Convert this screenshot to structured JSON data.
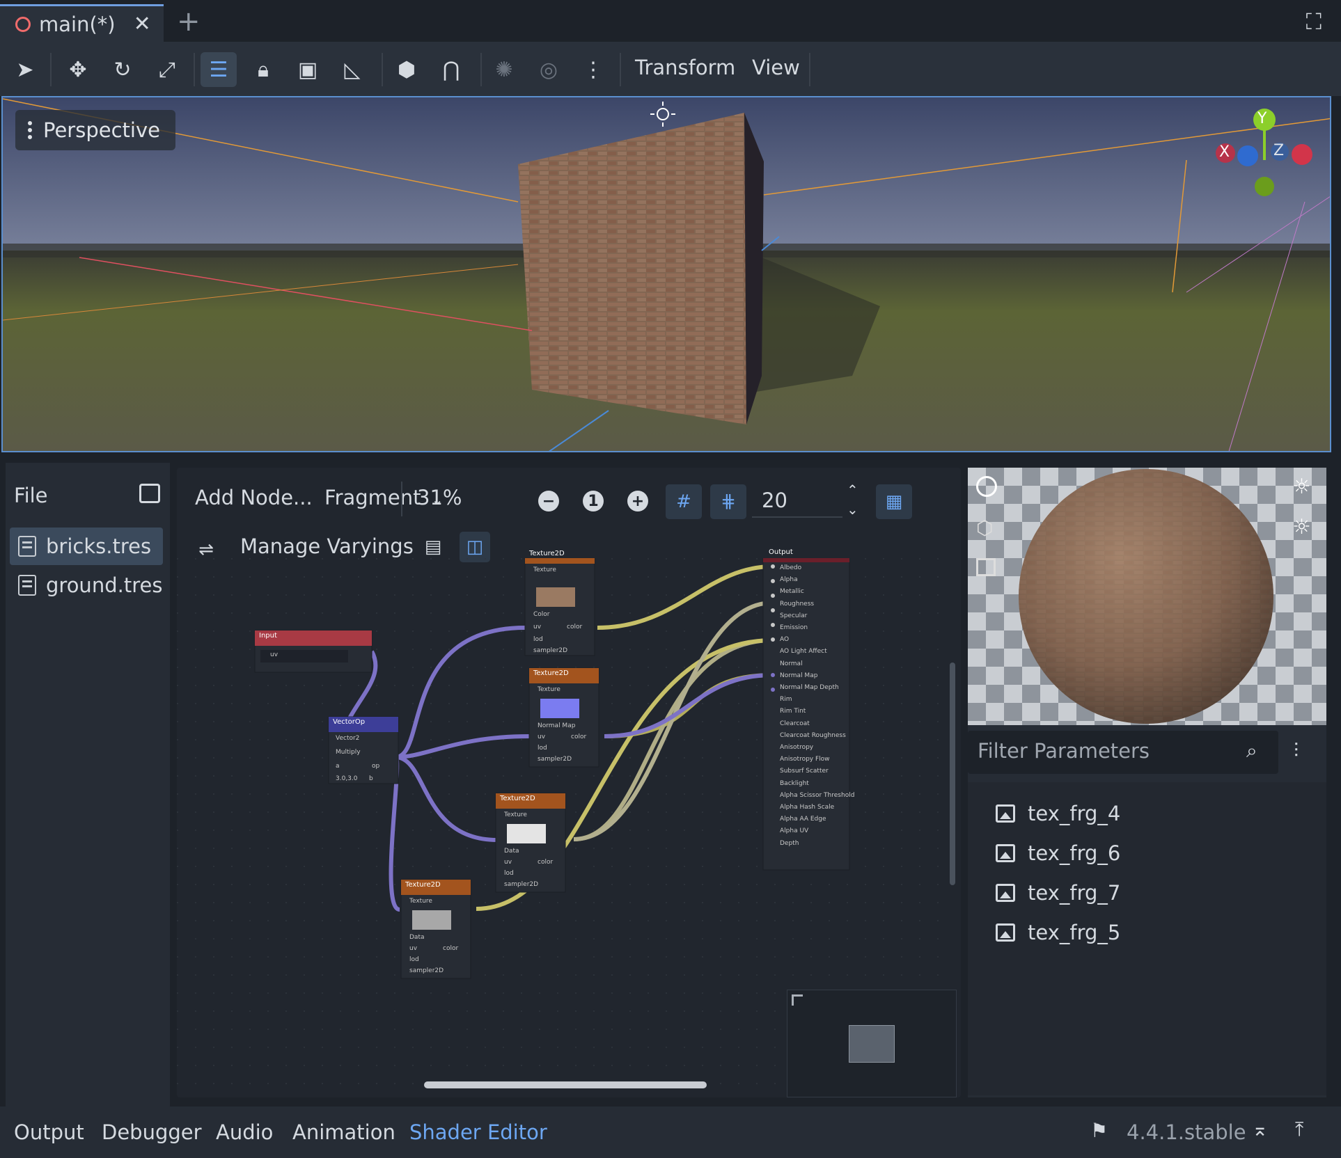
{
  "scene_tab": {
    "title": "main(*)",
    "close": "✕"
  },
  "toolbar": {
    "transform_label": "Transform",
    "view_label": "View",
    "icons": [
      "select-icon",
      "move-icon",
      "rotate-icon",
      "scale-icon",
      "list-select-icon",
      "lock-icon",
      "group-icon",
      "ruler-icon",
      "local-space-icon",
      "snap-icon",
      "sun-icon",
      "environment-icon",
      "more-icon"
    ]
  },
  "viewport": {
    "perspective_label": "Perspective",
    "gizmo": {
      "x": "X",
      "y": "Y",
      "z": "Z"
    }
  },
  "file_panel": {
    "title": "File",
    "files": [
      {
        "name": "bricks.tres",
        "selected": true
      },
      {
        "name": "ground.tres",
        "selected": false
      }
    ]
  },
  "shader_editor": {
    "add_node": "Add Node...",
    "mode": "Fragment",
    "zoom": "31%",
    "zoom_reset": "1",
    "grid_step": "20",
    "manage_varyings": "Manage Varyings",
    "nodes": {
      "input": {
        "title": "Input",
        "port": "uv"
      },
      "vectorop": {
        "title": "VectorOp",
        "type": "Vector2",
        "op": "Multiply",
        "a": "a",
        "op_lbl": "op",
        "b_val": "3.0,3.0",
        "b": "b"
      },
      "tex1": {
        "title": "Texture2D",
        "source": "Texture",
        "kind": "Color"
      },
      "tex2": {
        "title": "Texture2D",
        "source": "Texture",
        "kind": "Normal Map"
      },
      "tex3": {
        "title": "Texture2D",
        "source": "Texture",
        "kind": "Data"
      },
      "tex4": {
        "title": "Texture2D",
        "source": "Texture",
        "kind": "Data"
      },
      "ports": {
        "uv": "uv",
        "color": "color",
        "lod": "lod",
        "sampler": "sampler2D"
      },
      "output": {
        "title": "Output",
        "ports": [
          "Albedo",
          "Alpha",
          "Metallic",
          "Roughness",
          "Specular",
          "Emission",
          "AO",
          "AO Light Affect",
          "Normal",
          "Normal Map",
          "Normal Map Depth",
          "Rim",
          "Rim Tint",
          "Clearcoat",
          "Clearcoat Roughness",
          "Anisotropy",
          "Anisotropy Flow",
          "Subsurf Scatter",
          "Backlight",
          "Alpha Scissor Threshold",
          "Alpha Hash Scale",
          "Alpha AA Edge",
          "Alpha UV",
          "Depth"
        ]
      }
    }
  },
  "inspector": {
    "filter_placeholder": "Filter Parameters",
    "params": [
      "tex_frg_4",
      "tex_frg_6",
      "tex_frg_7",
      "tex_frg_5"
    ]
  },
  "dock": {
    "tabs": [
      "Output",
      "Debugger",
      "Audio",
      "Animation",
      "Shader Editor"
    ],
    "active": "Shader Editor",
    "version": "4.4.1.stable"
  },
  "colors": {
    "accent": "#6da7f2",
    "panel": "#262c35",
    "background": "#1d2229"
  }
}
